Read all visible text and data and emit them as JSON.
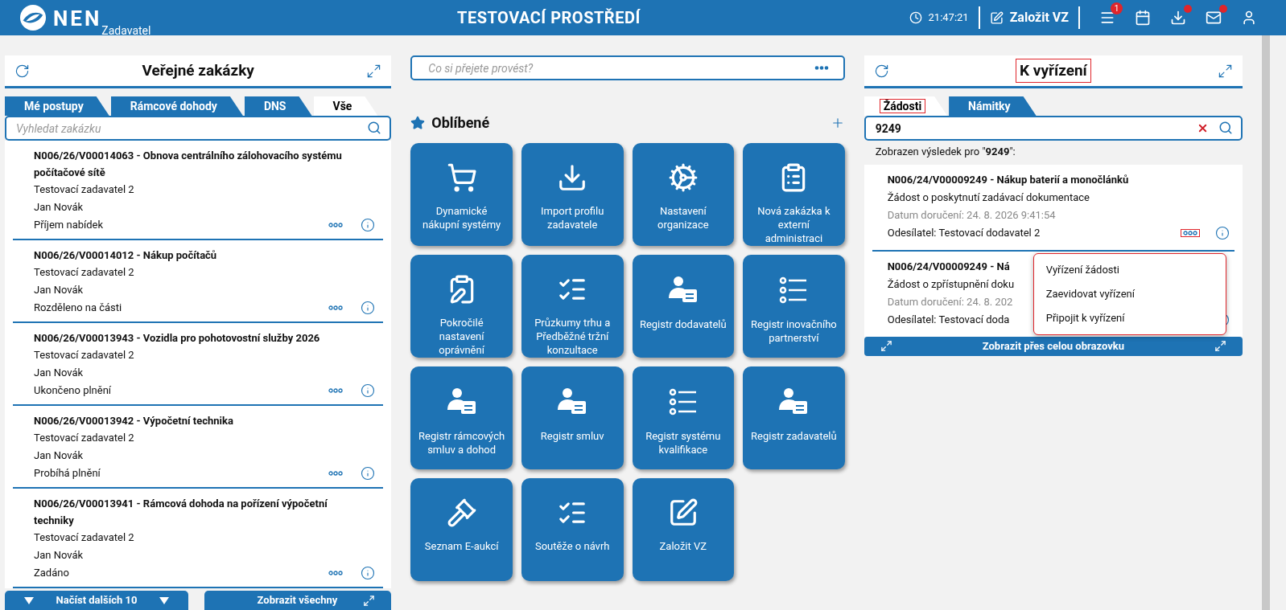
{
  "header": {
    "logo_text": "NEN",
    "logo_subtitle": "Zadavatel",
    "environment": "TESTOVACÍ PROSTŘEDÍ",
    "time": "21:47:21",
    "create_button": "Založit VZ",
    "icons": [
      {
        "kind": "menu",
        "badge": "1"
      },
      {
        "kind": "calendar",
        "dot": false
      },
      {
        "kind": "download",
        "dot": true
      },
      {
        "kind": "mail",
        "dot": true
      },
      {
        "kind": "user",
        "dot": false
      }
    ]
  },
  "left_panel": {
    "title": "Veřejné zakázky",
    "tabs": [
      {
        "label": "Mé postupy",
        "selected": false
      },
      {
        "label": "Rámcové dohody",
        "selected": false
      },
      {
        "label": "DNS",
        "selected": false
      },
      {
        "label": "Vše",
        "selected": true
      }
    ],
    "search": {
      "placeholder": "Vyhledat zakázku"
    },
    "items": [
      {
        "title": "N006/26/V00014063 - Obnova centrálního zálohovacího systému počítačové sítě",
        "contracting_authority": "Testovací zadavatel 2",
        "person": "Jan Novák",
        "status": "Příjem nabídek"
      },
      {
        "title": "N006/26/V00014012 - Nákup počítačů",
        "contracting_authority": "Testovací zadavatel 2",
        "person": "Jan Novák",
        "status": "Rozděleno na části"
      },
      {
        "title": "N006/26/V00013943 - Vozidla pro pohotovostní služby 2026",
        "contracting_authority": "Testovací zadavatel 2",
        "person": "Jan Novák",
        "status": "Ukončeno plnění"
      },
      {
        "title": "N006/26/V00013942 - Výpočetní technika",
        "contracting_authority": "Testovací zadavatel 2",
        "person": "Jan Novák",
        "status": "Probíhá plnění"
      },
      {
        "title": "N006/26/V00013941 - Rámcová dohoda na pořízení výpočetní techniky",
        "contracting_authority": "Testovací zadavatel 2",
        "person": "Jan Novák",
        "status": "Zadáno"
      }
    ],
    "load_more_button": "Načíst dalších 10",
    "show_all_button": "Zobrazit všechny"
  },
  "center_panel": {
    "command": {
      "placeholder": "Co si přejete provést?"
    },
    "favorites_title": "Oblíbené",
    "tiles": [
      {
        "label": "Dynamické nákupní systémy"
      },
      {
        "label": "Import profilu zadavatele"
      },
      {
        "label": "Nastavení organizace"
      },
      {
        "label": "Nová zakázka k externí administraci"
      },
      {
        "label": "Pokročilé nastavení oprávnění"
      },
      {
        "label": "Průzkumy trhu a Předběžné tržní konzultace"
      },
      {
        "label": "Registr dodavatelů"
      },
      {
        "label": "Registr inovačního partnerství"
      },
      {
        "label": "Registr rámcových smluv a dohod"
      },
      {
        "label": "Registr smluv"
      },
      {
        "label": "Registr systému kvalifikace"
      },
      {
        "label": "Registr zadavatelů"
      },
      {
        "label": "Seznam E-aukcí"
      },
      {
        "label": "Soutěže o návrh"
      },
      {
        "label": "Založit VZ"
      }
    ]
  },
  "right_panel": {
    "title": "K vyřízení",
    "title_highlighted": true,
    "tabs": [
      {
        "label": "Žádosti",
        "selected": true,
        "highlighted": true
      },
      {
        "label": "Námitky",
        "selected": false,
        "highlighted": false
      }
    ],
    "search": {
      "value": "9249"
    },
    "result_text": "Zobrazen výsledek pro \"**9249**\":",
    "items": [
      {
        "title": "N006/24/V00009249 - Nákup baterií a monočlánků",
        "request": "Žádost o poskytnutí zadávací dokumentace",
        "delivered": "Datum doručení: 24. 8. 2026 9:41:54",
        "sender": "Odesílatel: Testovací dodavatel 2",
        "menu_open": true
      },
      {
        "title": "N006/24/V00009249 - Ná",
        "request": "Žádost o zpřístupnění doku",
        "delivered": "Datum doručení: 24. 8. 202",
        "sender": "Odesílatel: Testovací doda",
        "menu_open": false
      }
    ],
    "context_menu": [
      "Vyřízení žádosti",
      "Zaevidovat vyřízení",
      "Připojit k vyřízení"
    ],
    "fullscreen_button": "Zobrazit přes celou obrazovku"
  }
}
